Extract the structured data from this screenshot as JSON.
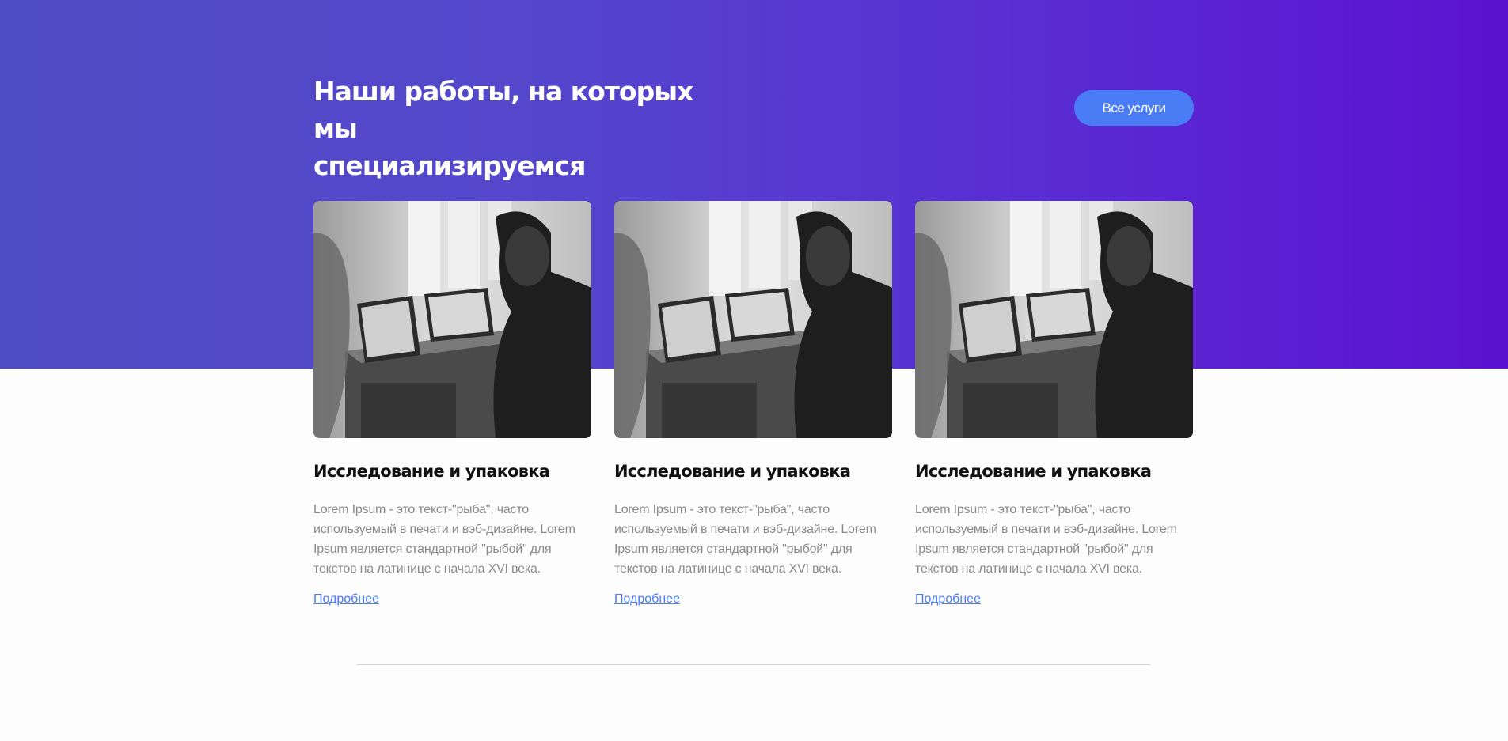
{
  "colors": {
    "hero_gradient_start": "#4f4bc3",
    "hero_gradient_end": "#5c12d1",
    "button_bg": "#4a7cf5",
    "link": "#4a7cf5",
    "body_text": "#8a8a8a"
  },
  "section": {
    "title_line1": "Наши работы, на которых мы",
    "title_line2": "специализируемся",
    "all_services_label": "Все услуги"
  },
  "cards": [
    {
      "image": "office-photo",
      "title": "Исследование и упаковка",
      "text": "Lorem Ipsum - это текст-\"рыба\", часто используемый в печати и вэб-дизайне. Lorem Ipsum является стандартной \"рыбой\" для текстов на латинице с начала XVI века.",
      "link_label": "Подробнее"
    },
    {
      "image": "office-photo",
      "title": "Исследование и упаковка",
      "text": "Lorem Ipsum - это текст-\"рыба\", часто используемый в печати и вэб-дизайне. Lorem Ipsum является стандартной \"рыбой\" для текстов на латинице с начала XVI века.",
      "link_label": "Подробнее"
    },
    {
      "image": "office-photo",
      "title": "Исследование и упаковка",
      "text": "Lorem Ipsum - это текст-\"рыба\", часто используемый в печати и вэб-дизайне. Lorem Ipsum является стандартной \"рыбой\" для текстов на латинице с начала XVI века.",
      "link_label": "Подробнее"
    }
  ]
}
